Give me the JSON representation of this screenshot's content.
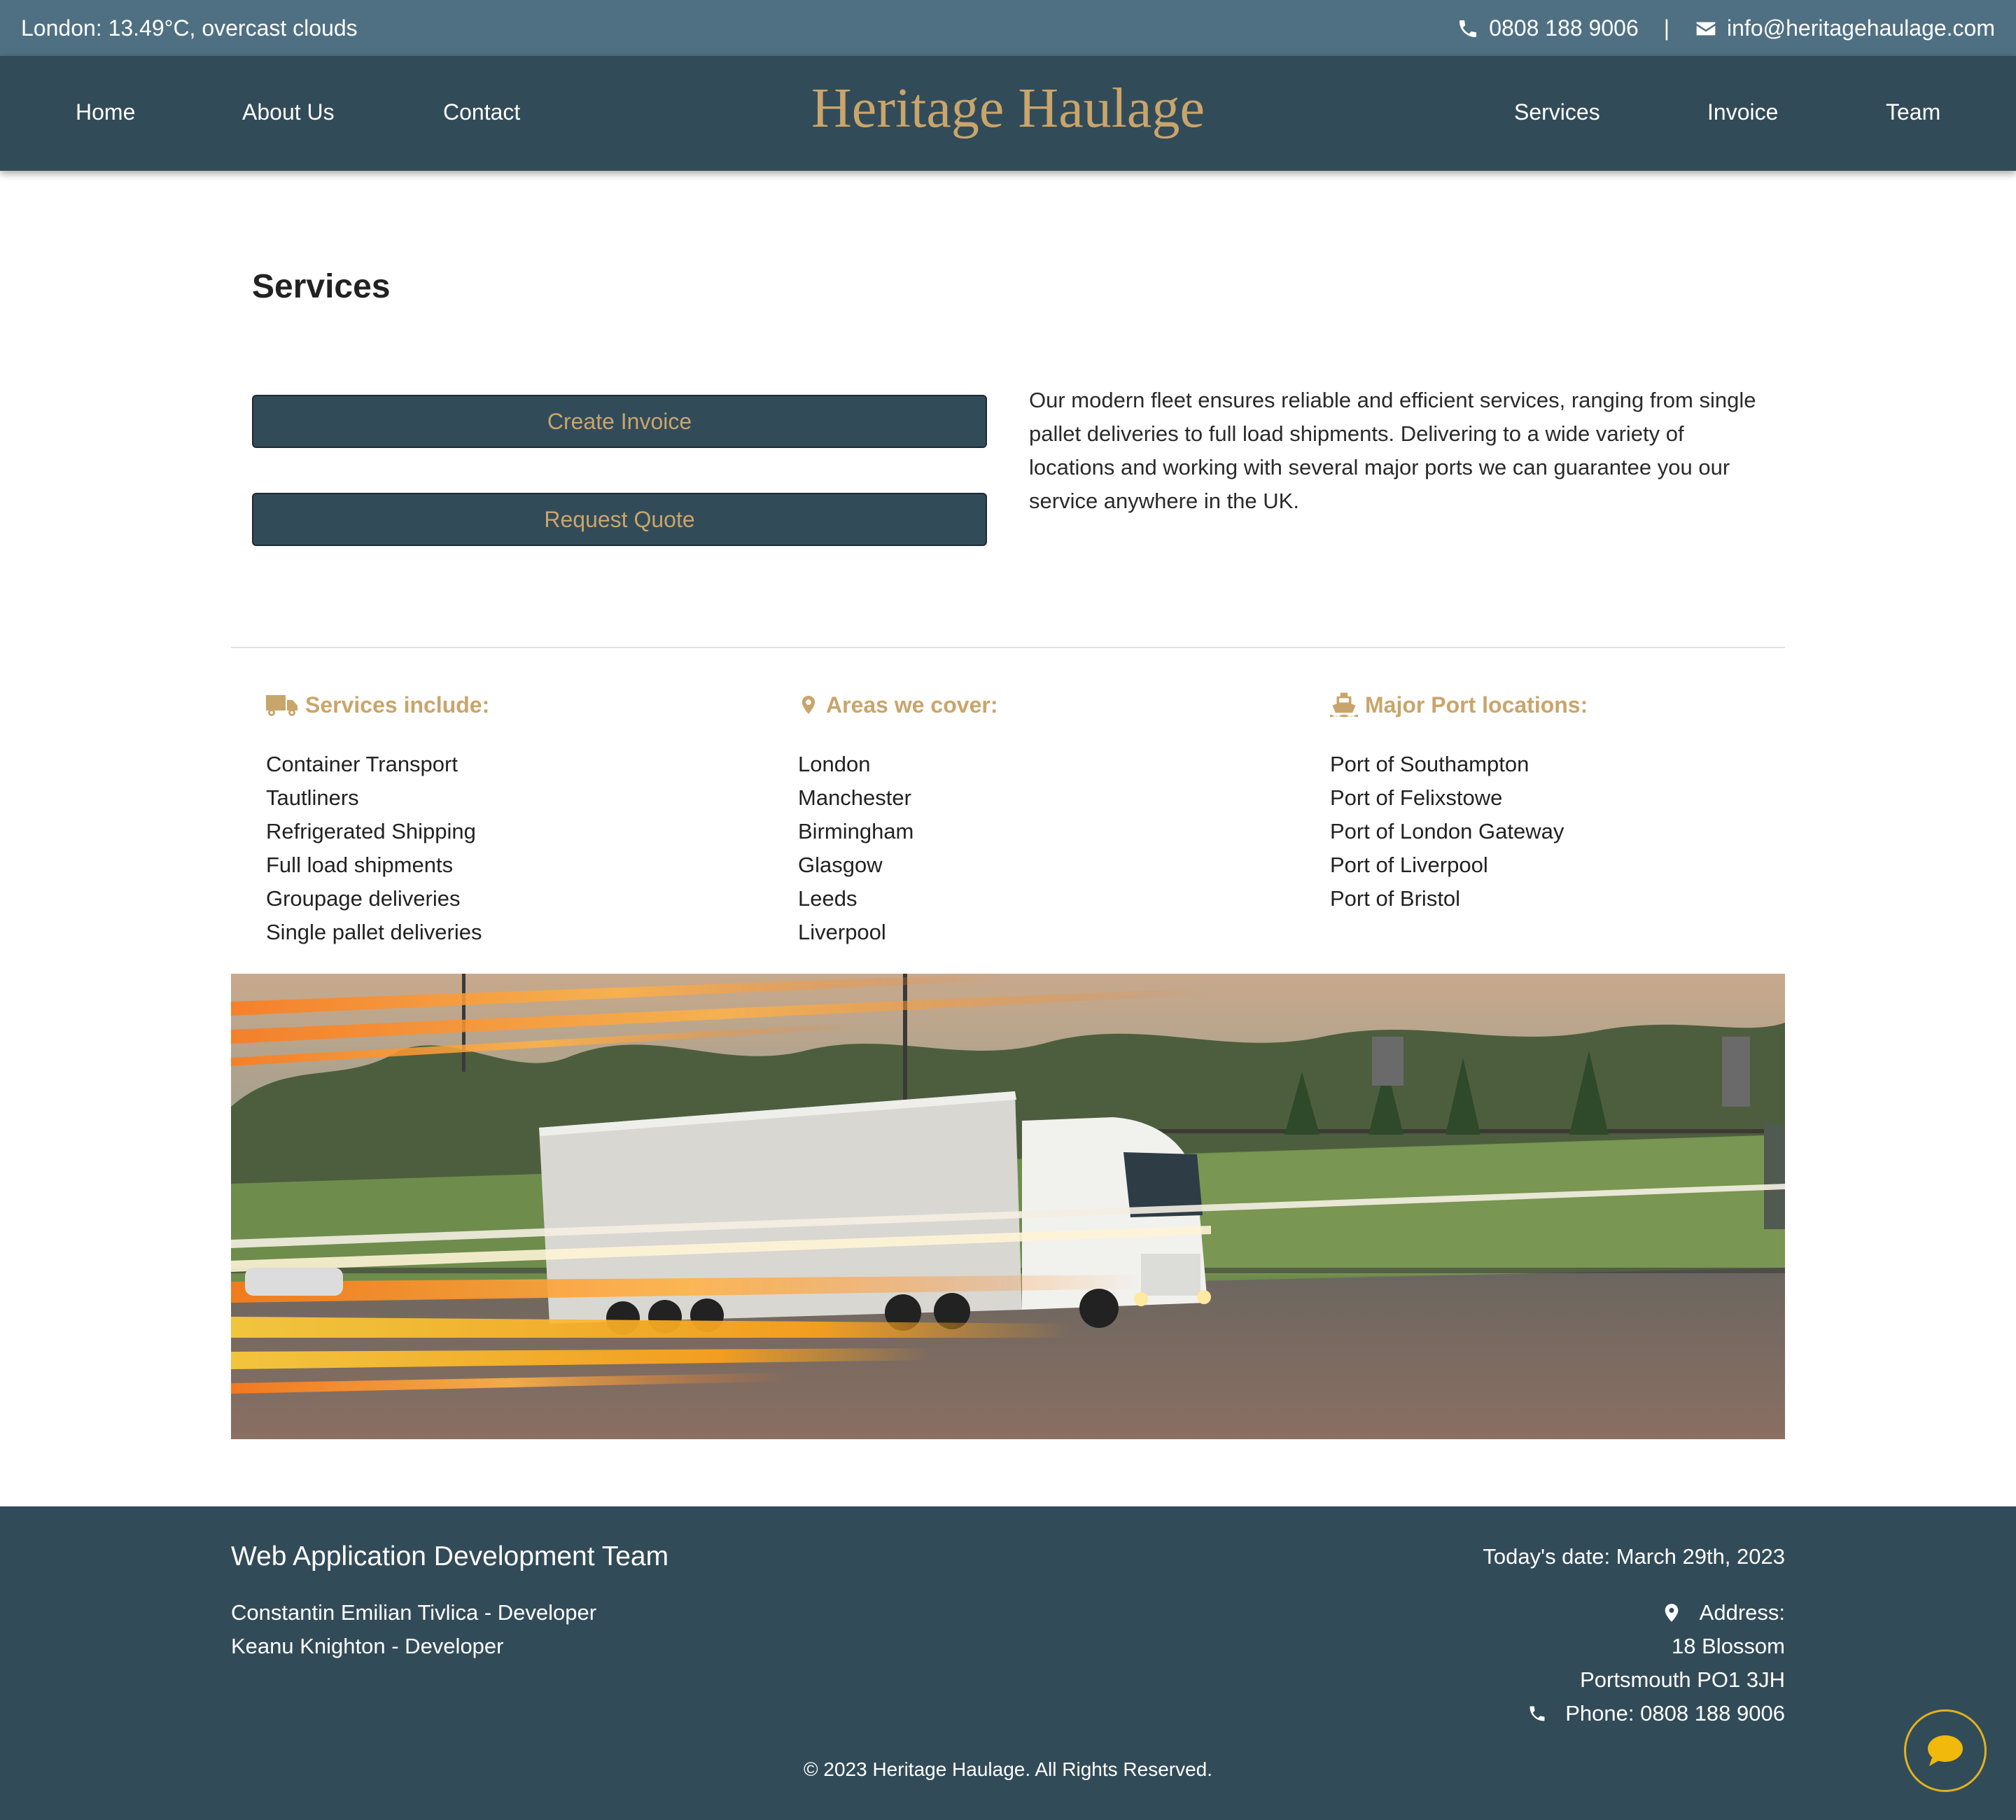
{
  "topbar": {
    "weather": "London: 13.49°C, overcast clouds",
    "phone": "0808 188 9006",
    "separator": "|",
    "email": "info@heritagehaulage.com"
  },
  "nav": {
    "brand": "Heritage Haulage",
    "left": [
      "Home",
      "About Us",
      "Contact"
    ],
    "right": [
      "Services",
      "Invoice",
      "Team"
    ]
  },
  "main": {
    "title": "Services",
    "create_invoice": "Create Invoice",
    "request_quote": "Request Quote",
    "intro": "Our modern fleet ensures reliable and efficient services, ranging from single pallet deliveries to full load shipments. Delivering to a wide variety of locations and working with several major ports we can guarantee you our service anywhere in the UK."
  },
  "columns": [
    {
      "icon": "truck-icon",
      "title": "Services include:",
      "items": [
        "Container Transport",
        "Tautliners",
        "Refrigerated Shipping",
        "Full load shipments",
        "Groupage deliveries",
        "Single pallet deliveries"
      ]
    },
    {
      "icon": "map-pin-icon",
      "title": "Areas we cover:",
      "items": [
        "London",
        "Manchester",
        "Birmingham",
        "Glasgow",
        "Leeds",
        "Liverpool"
      ]
    },
    {
      "icon": "ship-icon",
      "title": "Major Port locations:",
      "items": [
        "Port of Southampton",
        "Port of Felixstowe",
        "Port of London Gateway",
        "Port of Liverpool",
        "Port of Bristol"
      ]
    }
  ],
  "hero_image": "lorry-on-motorway-photo",
  "footer": {
    "team_title": "Web Application Development Team",
    "developers": [
      "Constantin Emilian Tivlica - Developer",
      "Keanu Knighton - Developer"
    ],
    "date": "Today's date: March 29th, 2023",
    "address_label": "Address:",
    "address_line1": "18 Blossom",
    "address_line2": "Portsmouth PO1 3JH",
    "phone": "Phone: 0808 188 9006",
    "copyright": "© 2023 Heritage Haulage. All Rights Reserved."
  },
  "colors": {
    "topbar": "#4f7082",
    "navy": "#324b59",
    "gold": "#c9a56b",
    "chat_ring": "#e0b21e"
  }
}
